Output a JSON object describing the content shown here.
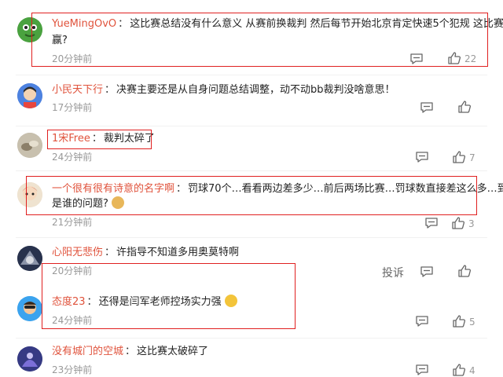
{
  "comments": [
    {
      "user": "YueMingOvO",
      "sep": "：",
      "text": "这比赛总结没有什么意义 从赛前换裁判 然后每节开始北京肯定快速5个犯规 这比赛你想",
      "text2": "赢?",
      "time": "20分钟前",
      "likes": "22"
    },
    {
      "user": "小民天下行",
      "sep": "：",
      "text": "决赛主要还是从自身问题总结调整，动不动bb裁判没啥意思！",
      "time": "17分钟前",
      "likes": ""
    },
    {
      "user": "1宋Free",
      "sep": "：",
      "text": "裁判太碎了",
      "time": "24分钟前",
      "likes": "7"
    },
    {
      "user": "一个很有很有诗意的名字啊",
      "sep": "：",
      "text": "罚球70个…看看两边差多少…前后两场比赛…罚球数直接差这么多…到底",
      "text2": "是谁的问题?",
      "time": "21分钟前",
      "likes": "3"
    },
    {
      "user": "心阳无悲伤",
      "sep": "：",
      "text": "许指导不知道多用奥莫特啊",
      "time": "20分钟前",
      "likes": "",
      "report": "投诉"
    },
    {
      "user": "态度23",
      "sep": "：",
      "text": "还得是闫军老师控场实力强",
      "time": "24分钟前",
      "likes": "5"
    },
    {
      "user": "没有城门的空城",
      "sep": "：",
      "text": "这比赛太破碎了",
      "time": "23分钟前",
      "likes": "4"
    }
  ],
  "icons": {
    "reply": "comment-icon",
    "like": "thumbs-up-icon"
  },
  "colors": {
    "username": "#e0533c",
    "highlight": "#e02020",
    "meta": "#999999"
  }
}
